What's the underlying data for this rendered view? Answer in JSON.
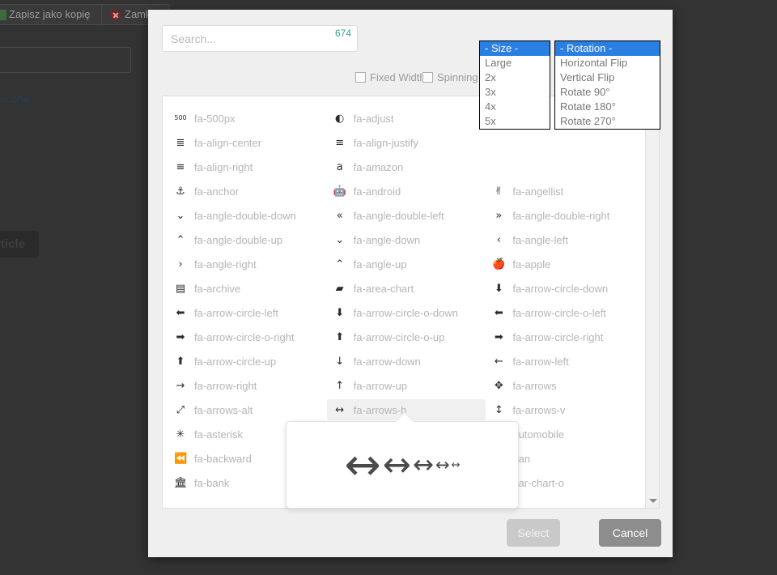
{
  "background": {
    "save_copy_button": "Zapisz jako kopię",
    "close_button": "Zamknij",
    "link_text": "gacone",
    "dark_button": "rticle"
  },
  "modal": {
    "search": {
      "placeholder": "Search...",
      "value": "",
      "count": "674",
      "count_color": "#3aa08c"
    },
    "options": {
      "fixed_width_label": "Fixed Width",
      "fixed_width_checked": false,
      "spinning_label": "Spinning",
      "spinning_checked": false,
      "size_select": {
        "value": "- Size -",
        "open": true,
        "options": [
          "- Size -",
          "Large",
          "2x",
          "3x",
          "4x",
          "5x"
        ],
        "selected_index": 0
      },
      "rotation_select": {
        "value": "- Rotation -",
        "open": true,
        "options": [
          "- Rotation -",
          "Horizontal Flip",
          "Vertical Flip",
          "Rotate 90°",
          "Rotate 180°",
          "Rotate 270°"
        ],
        "selected_index": 0
      }
    },
    "icons": {
      "hovered": "fa-arrows-h",
      "rows": [
        [
          {
            "name": "fa-500px",
            "glyph": "500",
            "small": true
          },
          {
            "name": "fa-adjust",
            "glyph": "◐"
          },
          {
            "name": "",
            "glyph": ""
          }
        ],
        [
          {
            "name": "fa-align-center",
            "glyph": "≣"
          },
          {
            "name": "fa-align-justify",
            "glyph": "≡"
          },
          {
            "name": "",
            "glyph": ""
          }
        ],
        [
          {
            "name": "fa-align-right",
            "glyph": "≡"
          },
          {
            "name": "fa-amazon",
            "glyph": "a"
          },
          {
            "name": "",
            "glyph": ""
          }
        ],
        [
          {
            "name": "fa-anchor",
            "glyph": "⚓"
          },
          {
            "name": "fa-android",
            "glyph": "🤖"
          },
          {
            "name": "fa-angellist",
            "glyph": "✌"
          }
        ],
        [
          {
            "name": "fa-angle-double-down",
            "glyph": "⌄"
          },
          {
            "name": "fa-angle-double-left",
            "glyph": "«"
          },
          {
            "name": "fa-angle-double-right",
            "glyph": "»"
          }
        ],
        [
          {
            "name": "fa-angle-double-up",
            "glyph": "⌃"
          },
          {
            "name": "fa-angle-down",
            "glyph": "⌄"
          },
          {
            "name": "fa-angle-left",
            "glyph": "‹"
          }
        ],
        [
          {
            "name": "fa-angle-right",
            "glyph": "›"
          },
          {
            "name": "fa-angle-up",
            "glyph": "⌃"
          },
          {
            "name": "fa-apple",
            "glyph": "🍎"
          }
        ],
        [
          {
            "name": "fa-archive",
            "glyph": "▤"
          },
          {
            "name": "fa-area-chart",
            "glyph": "▰"
          },
          {
            "name": "fa-arrow-circle-down",
            "glyph": "⬇"
          }
        ],
        [
          {
            "name": "fa-arrow-circle-left",
            "glyph": "⬅"
          },
          {
            "name": "fa-arrow-circle-o-down",
            "glyph": "⬇"
          },
          {
            "name": "fa-arrow-circle-o-left",
            "glyph": "⬅"
          }
        ],
        [
          {
            "name": "fa-arrow-circle-o-right",
            "glyph": "➡"
          },
          {
            "name": "fa-arrow-circle-o-up",
            "glyph": "⬆"
          },
          {
            "name": "fa-arrow-circle-right",
            "glyph": "➡"
          }
        ],
        [
          {
            "name": "fa-arrow-circle-up",
            "glyph": "⬆"
          },
          {
            "name": "fa-arrow-down",
            "glyph": "↓"
          },
          {
            "name": "fa-arrow-left",
            "glyph": "←"
          }
        ],
        [
          {
            "name": "fa-arrow-right",
            "glyph": "→"
          },
          {
            "name": "fa-arrow-up",
            "glyph": "↑"
          },
          {
            "name": "fa-arrows",
            "glyph": "✥"
          }
        ],
        [
          {
            "name": "fa-arrows-alt",
            "glyph": "⤢"
          },
          {
            "name": "fa-arrows-h",
            "glyph": "↔"
          },
          {
            "name": "fa-arrows-v",
            "glyph": "↕"
          }
        ],
        [
          {
            "name": "fa-asterisk",
            "glyph": "✳"
          },
          {
            "name": "",
            "glyph": ""
          },
          {
            "name": "automobile",
            "glyph": ""
          }
        ],
        [
          {
            "name": "fa-backward",
            "glyph": "⏪"
          },
          {
            "name": "",
            "glyph": ""
          },
          {
            "name": "oan",
            "glyph": ""
          }
        ],
        [
          {
            "name": "fa-bank",
            "glyph": "🏛"
          },
          {
            "name": "",
            "glyph": ""
          },
          {
            "name": "oar-chart-o",
            "glyph": ""
          }
        ]
      ],
      "preview_sizes": [
        "5x",
        "4x",
        "3x",
        "2x",
        "lg"
      ]
    },
    "footer": {
      "select_label": "Select",
      "select_disabled": true,
      "cancel_label": "Cancel"
    }
  }
}
